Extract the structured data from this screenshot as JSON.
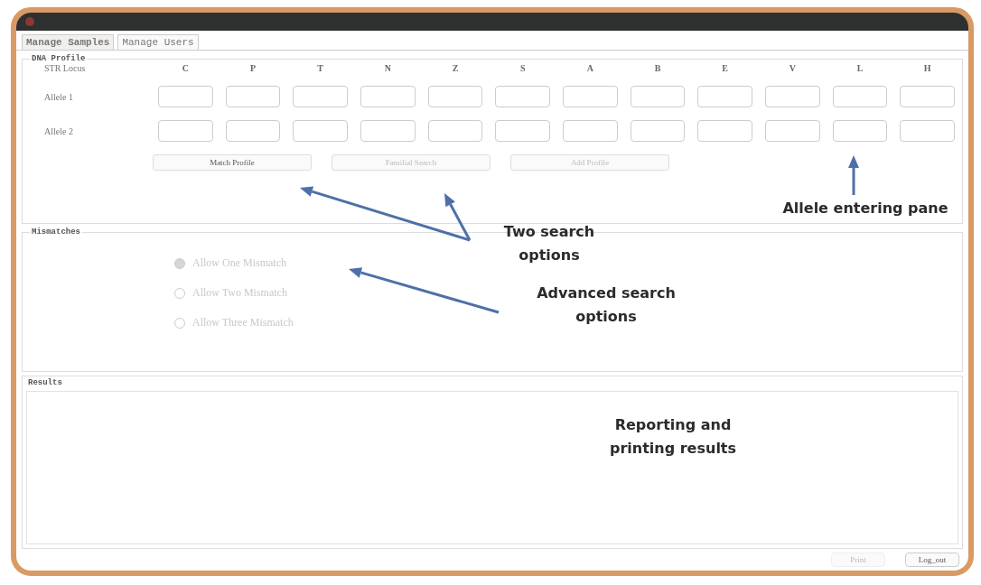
{
  "tabs": [
    {
      "label": "Manage Samples",
      "selected": true
    },
    {
      "label": "Manage Users",
      "selected": false
    }
  ],
  "dna_profile": {
    "title": "DNA Profile",
    "locus_label": "STR Locus",
    "loci": [
      "C",
      "P",
      "T",
      "N",
      "Z",
      "S",
      "A",
      "B",
      "E",
      "V",
      "L",
      "H"
    ],
    "rows": [
      {
        "label": "Allele 1"
      },
      {
        "label": "Allele 2"
      }
    ],
    "buttons": [
      {
        "label": "Match Profile",
        "disabled": false
      },
      {
        "label": "Familial Search",
        "disabled": true
      },
      {
        "label": "Add Profile",
        "disabled": true
      }
    ]
  },
  "mismatches": {
    "title": "Mismatches",
    "options": [
      {
        "label": "Allow One Mismatch",
        "selected": true,
        "disabled": true
      },
      {
        "label": "Allow Two Mismatch",
        "selected": false,
        "disabled": true
      },
      {
        "label": "Allow Three Mismatch",
        "selected": false,
        "disabled": true
      }
    ]
  },
  "results": {
    "title": "Results"
  },
  "footer_buttons": [
    {
      "label": "Print",
      "disabled": true
    },
    {
      "label": "Log_out",
      "disabled": false
    }
  ],
  "annotations": [
    {
      "text": "Allele entering pane"
    },
    {
      "text": "Two search options"
    },
    {
      "text": "Advanced search options"
    },
    {
      "text": "Reporting and printing results"
    }
  ]
}
